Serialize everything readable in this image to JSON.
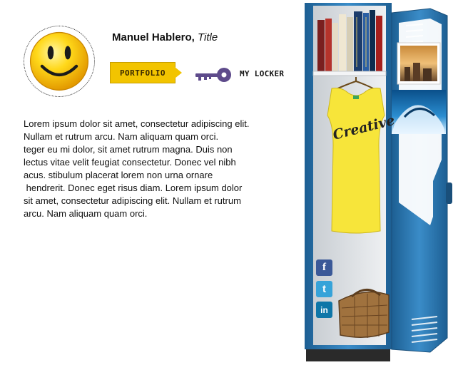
{
  "profile": {
    "name": "Manuel Hablero,",
    "title": "Title",
    "avatar_icon": "smiley-face-icon"
  },
  "nav": {
    "portfolio_label": "PORTFOLIO",
    "locker_label": "MY LOCKER",
    "key_icon": "key-icon"
  },
  "bio": {
    "lines": [
      "Lorem ipsum dolor sit amet, consectetur adipiscing elit.",
      "Nullam et rutrum arcu. Nam aliquam quam orci.",
      "teger eu mi dolor, sit amet rutrum magna. Duis non",
      "lectus vitae velit feugiat consectetur. Donec vel nibh",
      "acus. stibulum placerat lorem non urna ornare",
      " hendrerit. Donec eget risus diam. Lorem ipsum dolor",
      "sit amet, consectetur adipiscing elit. Nullam et rutrum",
      "arcu. Nam aliquam quam orci."
    ]
  },
  "locker": {
    "shirt_text": "Creative",
    "social": {
      "facebook": "f",
      "twitter": "t",
      "linkedin": "in"
    }
  },
  "colors": {
    "locker_blue": "#2f7db8",
    "locker_dark": "#1d5f93",
    "accent_yellow": "#f2c400",
    "shirt_yellow": "#f7e53a",
    "key_purple": "#5e4b8b"
  }
}
